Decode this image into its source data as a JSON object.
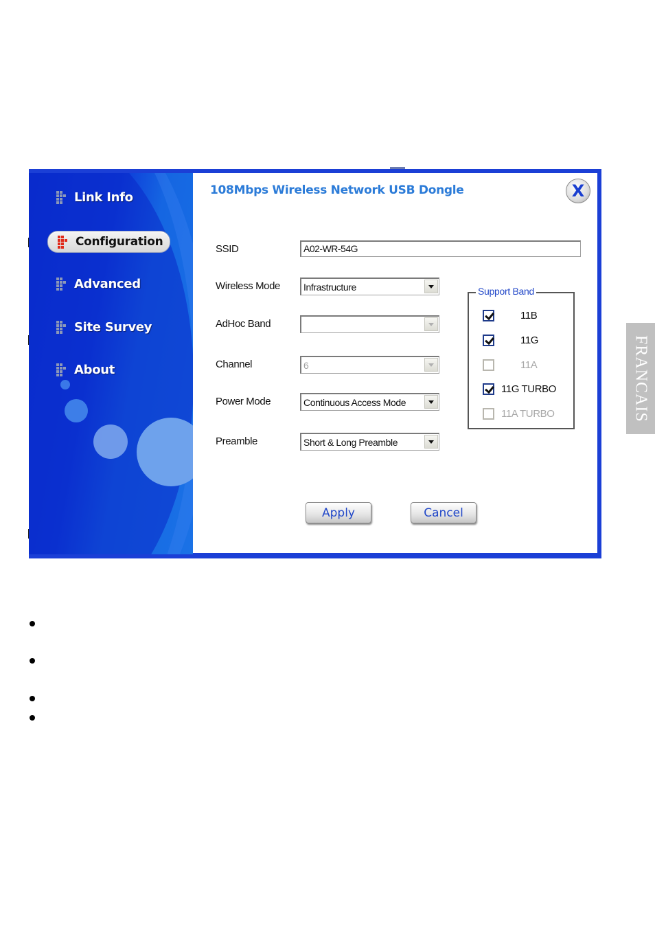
{
  "window": {
    "title": "108Mbps Wireless Network USB Dongle",
    "close_icon": "close-icon (X)"
  },
  "sidebar": {
    "items": [
      {
        "label": "Link Info",
        "icon": "bars-icon",
        "active": false
      },
      {
        "label": "Configuration",
        "icon": "bars-icon",
        "active": true
      },
      {
        "label": "Advanced",
        "icon": "bars-icon",
        "active": false
      },
      {
        "label": "Site Survey",
        "icon": "bars-icon",
        "active": false
      },
      {
        "label": "About",
        "icon": "bars-icon",
        "active": false
      }
    ]
  },
  "form": {
    "ssid": {
      "label": "SSID",
      "value": "A02-WR-54G"
    },
    "wireless_mode": {
      "label": "Wireless Mode",
      "value": "Infrastructure"
    },
    "adhoc_band": {
      "label": "AdHoc Band",
      "value": ""
    },
    "channel": {
      "label": "Channel",
      "value": "6"
    },
    "power_mode": {
      "label": "Power Mode",
      "value": "Continuous Access Mode"
    },
    "preamble": {
      "label": "Preamble",
      "value": "Short & Long Preamble"
    }
  },
  "support_band": {
    "legend": "Support Band",
    "options": [
      {
        "label": "11B",
        "checked": true,
        "enabled": true
      },
      {
        "label": "11G",
        "checked": true,
        "enabled": true
      },
      {
        "label": "11A",
        "checked": false,
        "enabled": false
      },
      {
        "label": "11G TURBO",
        "checked": true,
        "enabled": true
      },
      {
        "label": "11A TURBO",
        "checked": false,
        "enabled": false
      }
    ]
  },
  "buttons": {
    "apply": "Apply",
    "cancel": "Cancel"
  },
  "page": {
    "language_tab": "FRANCAIS",
    "bullet_count": 4
  }
}
